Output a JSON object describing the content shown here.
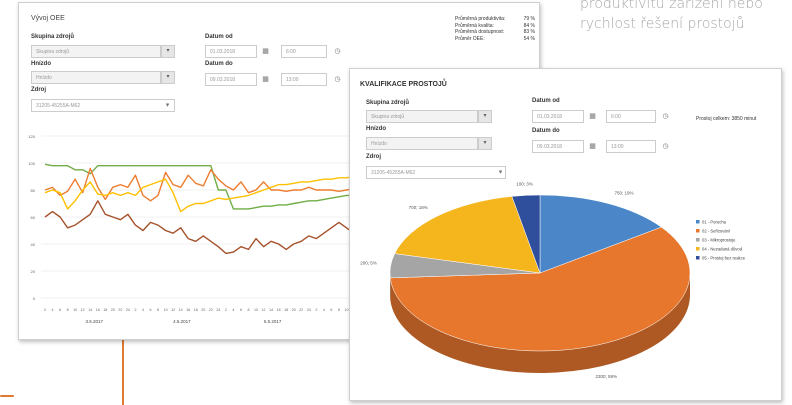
{
  "caption": {
    "lines": [
      "produktivitu zařízení nebo",
      "rychlost řešení prostojů"
    ]
  },
  "oee_panel": {
    "title": "Vývoj OEE",
    "group_label": "Skupina zdrojů",
    "group_value": "Skupina zdrojů",
    "nest_label": "Hnízdo",
    "nest_value": "Hnízdo",
    "source_label": "Zdroj",
    "source_value": "31205-45255A-M62",
    "date_from_label": "Datum od",
    "date_from": "01.03.2018",
    "time_from": "6:00",
    "date_to_label": "Datum do",
    "date_to": "09.03.2018",
    "time_to": "13:00",
    "stats": [
      {
        "label": "Průměrná produktivita:",
        "value": "79 %"
      },
      {
        "label": "Průměrná kvalita:",
        "value": "84 %"
      },
      {
        "label": "Průměrná dostupnost:",
        "value": "83 %"
      },
      {
        "label": "Průměr OEE:",
        "value": "54 %"
      }
    ],
    "chart_data": {
      "type": "line",
      "ylim": [
        0,
        120
      ],
      "yticks": [
        "0",
        "20",
        "40",
        "60",
        "80",
        "100",
        "120"
      ],
      "xticks": [
        "2",
        "4",
        "6",
        "8",
        "10",
        "12",
        "14",
        "16",
        "18",
        "20",
        "22",
        "24",
        "2",
        "4",
        "6",
        "8",
        "10",
        "12",
        "14",
        "16",
        "18",
        "20",
        "22",
        "24",
        "2",
        "4",
        "6",
        "8",
        "10",
        "12",
        "14",
        "16",
        "18",
        "20",
        "22",
        "24",
        "2",
        "4",
        "6",
        "8",
        "10",
        "12"
      ],
      "date_labels": [
        "3.5.2017",
        "4.5.2017",
        "5.5.2017"
      ],
      "series": [
        {
          "color": "#70ad47",
          "values": [
            99,
            98,
            98,
            98,
            95,
            95,
            92,
            98,
            98,
            98,
            98,
            98,
            98,
            98,
            98,
            98,
            98,
            98,
            98,
            98,
            98,
            98,
            98,
            80,
            80,
            66,
            66,
            66,
            67,
            68,
            68,
            69,
            69,
            70,
            71,
            72,
            72,
            73,
            74,
            75,
            76,
            76
          ]
        },
        {
          "color": "#ed7d31",
          "values": [
            80,
            82,
            76,
            79,
            88,
            78,
            96,
            82,
            73,
            82,
            84,
            82,
            91,
            76,
            72,
            76,
            93,
            84,
            82,
            91,
            85,
            83,
            95,
            88,
            83,
            80,
            86,
            78,
            80,
            86,
            80,
            80,
            79,
            80,
            80,
            82,
            80,
            80,
            80,
            79,
            80,
            81
          ]
        },
        {
          "color": "#ffc000",
          "values": [
            78,
            80,
            78,
            66,
            72,
            80,
            86,
            77,
            76,
            78,
            76,
            78,
            76,
            82,
            84,
            86,
            88,
            78,
            64,
            68,
            70,
            70,
            72,
            74,
            73,
            74,
            75,
            76,
            78,
            80,
            82,
            84,
            84,
            85,
            86,
            86,
            87,
            88,
            88,
            89,
            89,
            90
          ]
        },
        {
          "color": "#a5522b",
          "values": [
            60,
            64,
            60,
            52,
            54,
            58,
            62,
            72,
            62,
            60,
            58,
            62,
            54,
            50,
            56,
            54,
            50,
            48,
            52,
            44,
            42,
            46,
            42,
            38,
            33,
            34,
            38,
            36,
            44,
            38,
            42,
            40,
            36,
            40,
            42,
            46,
            44,
            48,
            52,
            56,
            52,
            48
          ]
        }
      ]
    }
  },
  "downtime_panel": {
    "title": "KVALIFIKACE PROSTOJŮ",
    "group_label": "Skupina zdrojů",
    "group_value": "Skupina zdrojů",
    "nest_label": "Hnízdo",
    "nest_value": "Hnízdo",
    "source_label": "Zdroj",
    "source_value": "31205-45255A-M62",
    "date_from_label": "Datum od",
    "date_from": "01.03.2018",
    "time_from": "6:00",
    "date_to_label": "Datum do",
    "date_to": "09.03.2018",
    "time_to": "13:00",
    "total": "Prostoj celkem: 3850 minut",
    "chart_data": {
      "type": "pie",
      "slices": [
        {
          "label": "01 - Porucha",
          "value": 15,
          "data_label": "750; 19%",
          "color": "#4a86c8"
        },
        {
          "label": "02 - Seřizování",
          "value": 59,
          "data_label": "2300; 59%",
          "color": "#e8772e"
        },
        {
          "label": "03 - Mikroprostoje",
          "value": 5,
          "data_label": "200; 5%",
          "color": "#a5a5a5"
        },
        {
          "label": "04 - Nezadaná důvod",
          "value": 18,
          "data_label": "700; 18%",
          "color": "#f5b51d"
        },
        {
          "label": "05 - Prostoj bez reakce",
          "value": 3,
          "data_label": "100; 3%",
          "color": "#2f4f9d"
        }
      ]
    }
  }
}
